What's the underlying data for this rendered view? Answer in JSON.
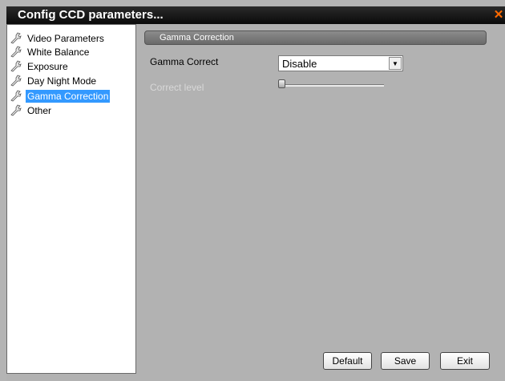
{
  "window": {
    "title": "Config CCD parameters...",
    "close_glyph": "✕"
  },
  "tree": {
    "items": [
      {
        "label": "Video Parameters",
        "icon": "wrench-icon",
        "selected": false
      },
      {
        "label": "White Balance",
        "icon": "wrench-icon",
        "selected": false
      },
      {
        "label": "Exposure",
        "icon": "wrench-icon",
        "selected": false
      },
      {
        "label": "Day Night Mode",
        "icon": "wrench-icon",
        "selected": false
      },
      {
        "label": "Gamma Correction",
        "icon": "wrench-icon",
        "selected": true
      },
      {
        "label": "Other",
        "icon": "wrench-icon",
        "selected": false
      }
    ]
  },
  "panel": {
    "section_title": "Gamma Correction",
    "gamma_label": "Gamma Correct",
    "gamma_value": "Disable",
    "level_label": "Correct level",
    "level_value_fraction": 0.0
  },
  "buttons": {
    "default_label": "Default",
    "save_label": "Save",
    "exit_label": "Exit"
  },
  "colors": {
    "selection": "#3399ff",
    "titlebar": "#111111",
    "close": "#ff6a00",
    "panel_bg": "#b2b2b2"
  }
}
